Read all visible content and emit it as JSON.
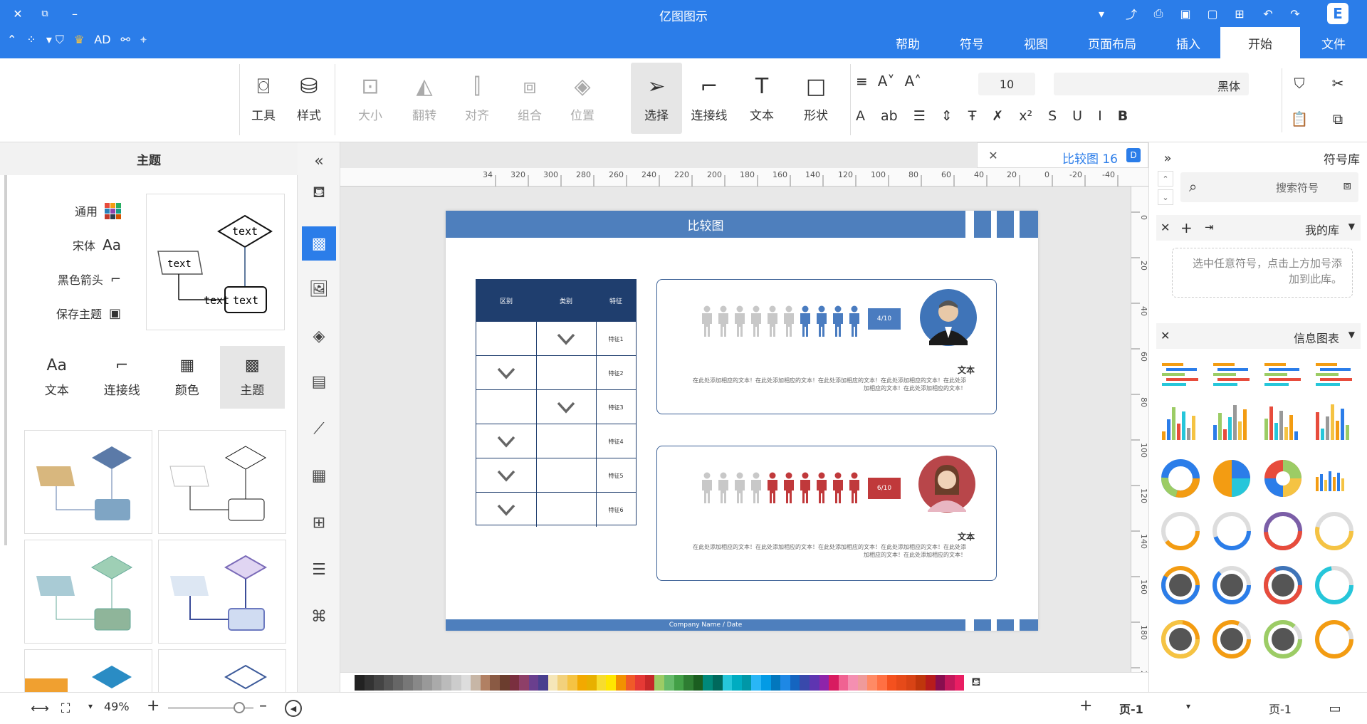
{
  "app": {
    "title": "亿图图示"
  },
  "titlebar": {
    "left_icons": [
      "close-icon",
      "restore-icon",
      "minimize-icon"
    ],
    "right_icons": [
      "dropdown-icon",
      "export-icon",
      "print-icon",
      "save-icon",
      "open-icon",
      "new-icon",
      "undo-icon",
      "redo-icon",
      "logo-icon"
    ]
  },
  "quickbar": {
    "ad_label": "AD"
  },
  "menu": {
    "tabs": [
      {
        "label": "帮助"
      },
      {
        "label": "符号"
      },
      {
        "label": "视图"
      },
      {
        "label": "页面布局"
      },
      {
        "label": "插入"
      },
      {
        "label": "开始"
      },
      {
        "label": "文件"
      }
    ],
    "active": "开始"
  },
  "ribbon": {
    "tools_label": "工具",
    "style_label": "样式",
    "size_label": "大小",
    "flip_label": "翻转",
    "align_label": "对齐",
    "group_label": "组合",
    "position_label": "位置",
    "select_label": "选择",
    "connector_label": "连接线",
    "text_label": "文本",
    "shape_label": "形状",
    "font_size": "10",
    "font_name": "黑体"
  },
  "left_panel": {
    "title": "主题",
    "options": [
      {
        "label": "通用",
        "icon": "grid-color-icon"
      },
      {
        "label": "宋体",
        "icon": "font-aa-icon"
      },
      {
        "label": "黑色箭头",
        "icon": "arrow-connector-icon"
      },
      {
        "label": "保存主题",
        "icon": "save-theme-icon"
      }
    ],
    "preview_texts": [
      "text",
      "text",
      "text"
    ],
    "tabs": [
      {
        "label": "文本",
        "icon": "Aa"
      },
      {
        "label": "连接线",
        "icon": "⌐"
      },
      {
        "label": "颜色",
        "icon": "▦"
      },
      {
        "label": "主题",
        "icon": "▩"
      }
    ]
  },
  "document": {
    "tab_title": "比较图 16",
    "page_title": "比较图",
    "footer_text": "Company Name / Date",
    "table": {
      "headers": [
        "区别",
        "类别",
        "特征"
      ],
      "rows": [
        {
          "label": "特征1",
          "checks": [
            false,
            true
          ]
        },
        {
          "label": "特征2",
          "checks": [
            true,
            false
          ]
        },
        {
          "label": "特征3",
          "checks": [
            false,
            true
          ]
        },
        {
          "label": "特征4",
          "checks": [
            true,
            false
          ]
        },
        {
          "label": "特征5",
          "checks": [
            true,
            false
          ]
        },
        {
          "label": "特征6",
          "checks": [
            true,
            false
          ]
        }
      ]
    },
    "cards": [
      {
        "label": "文本",
        "ratio": "4/10",
        "body": "在此处添加相应的文本！在此处添加相应的文本！在此处添加相应的文本！在此处添加相应的文本！在此处添加相应的文本！在此处添加相应的文本！",
        "color": "#4a7cc0",
        "filled": 4,
        "total": 10
      },
      {
        "label": "文本",
        "ratio": "6/10",
        "body": "在此处添加相应的文本！在此处添加相应的文本！在此处添加相应的文本！在此处添加相应的文本！在此处添加相应的文本！在此处添加相应的文本！",
        "color": "#c0393b",
        "filled": 6,
        "total": 10
      }
    ]
  },
  "ruler": {
    "top": [
      "-40",
      "-20",
      "0",
      "20",
      "40",
      "60",
      "80",
      "100",
      "120",
      "140",
      "160",
      "180",
      "200",
      "220",
      "240",
      "260",
      "280",
      "300",
      "320",
      "34"
    ],
    "left": [
      "0",
      "20",
      "40",
      "60",
      "80",
      "100",
      "120",
      "140",
      "160",
      "180",
      "200",
      "20"
    ]
  },
  "right_panel": {
    "title": "符号库",
    "search_placeholder": "搜索符号",
    "my_lib": "我的库",
    "my_lib_hint": "选中任意符号，点击上方加号添加到此库。",
    "info_lib": "信息图表"
  },
  "status": {
    "page_tab": "页-1",
    "page_select": "页-1",
    "zoom": "49%"
  },
  "colors": {
    "brand": "#2b7de9",
    "header_navy": "#1f3e6e",
    "accent_blue": "#4a7cc0",
    "accent_red": "#c0393b"
  }
}
